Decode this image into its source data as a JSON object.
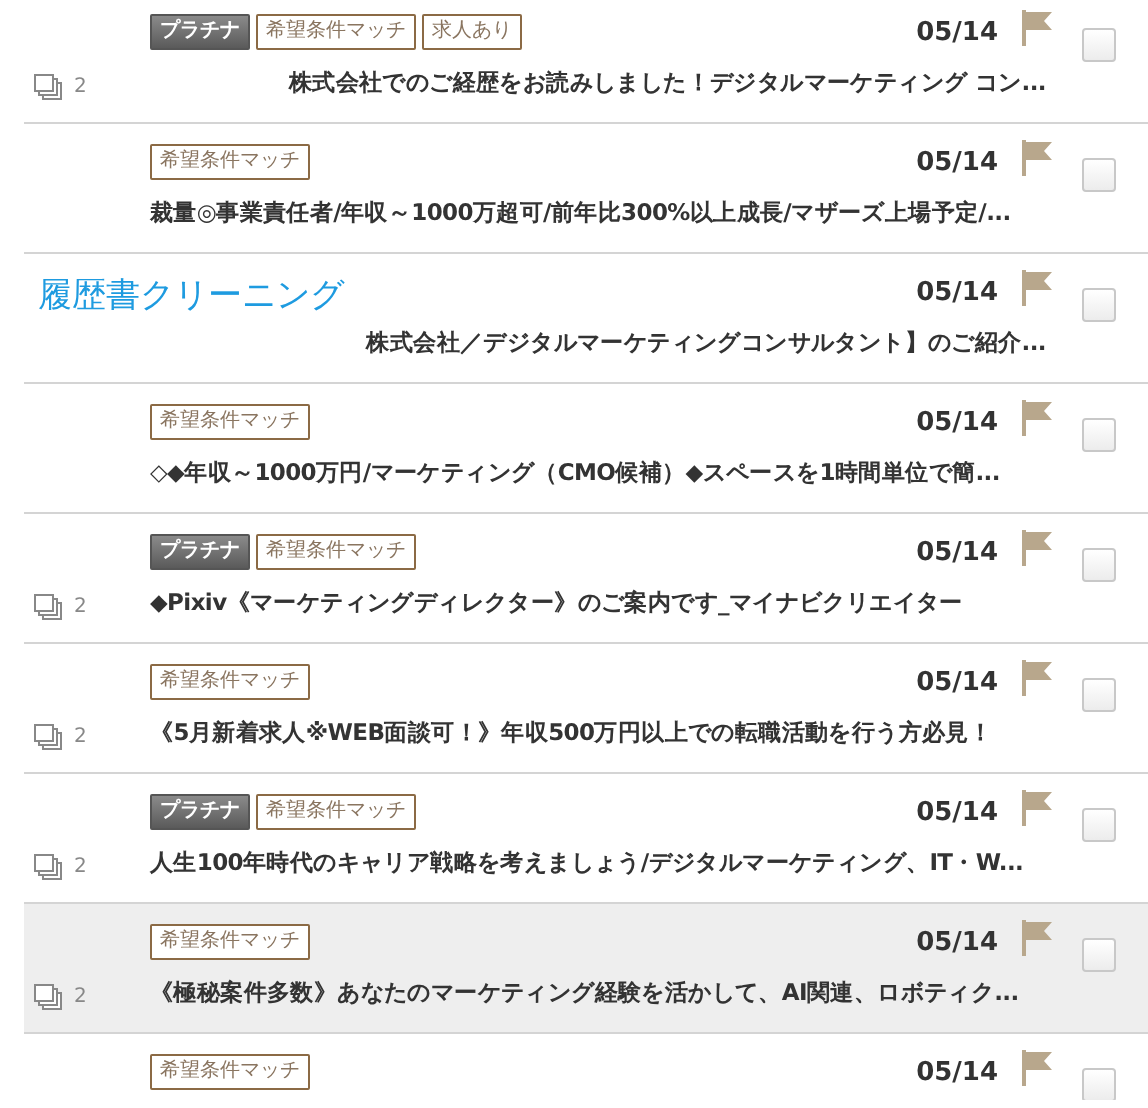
{
  "overlay": {
    "text": "履歴書クリーニング"
  },
  "rows": [
    {
      "highlighted": false,
      "covered": true,
      "thread_count": "2",
      "tags": [
        {
          "kind": "platinum",
          "label": "プラチナ"
        },
        {
          "kind": "outline",
          "label": "希望条件マッチ"
        },
        {
          "kind": "outline",
          "label": "求人あり"
        }
      ],
      "date": "05/14",
      "title": "株式会社でのご経歴をお読みしました！デジタルマーケティング コン...",
      "checked": false
    },
    {
      "highlighted": false,
      "covered": false,
      "tags": [
        {
          "kind": "outline",
          "label": "希望条件マッチ"
        }
      ],
      "date": "05/14",
      "title": "裁量◎事業責任者/年収～1000万超可/前年比300%以上成長/マザーズ上場予定/...",
      "checked": false
    },
    {
      "highlighted": false,
      "covered": true,
      "tags": [],
      "date": "05/14",
      "title": "株式会社／デジタルマーケティングコンサルタント】のご紹介...",
      "checked": false
    },
    {
      "highlighted": false,
      "covered": false,
      "tags": [
        {
          "kind": "outline",
          "label": "希望条件マッチ"
        }
      ],
      "date": "05/14",
      "title": "◇◆年収～1000万円/マーケティング（CMO候補）◆スペースを1時間単位で簡...",
      "checked": false
    },
    {
      "highlighted": false,
      "covered": false,
      "thread_count": "2",
      "tags": [
        {
          "kind": "platinum",
          "label": "プラチナ"
        },
        {
          "kind": "outline",
          "label": "希望条件マッチ"
        }
      ],
      "date": "05/14",
      "title": "◆Pixiv《マーケティングディレクター》のご案内です_マイナビクリエイター",
      "checked": false
    },
    {
      "highlighted": false,
      "covered": false,
      "thread_count": "2",
      "tags": [
        {
          "kind": "outline",
          "label": "希望条件マッチ"
        }
      ],
      "date": "05/14",
      "title": "《5月新着求人※WEB面談可！》年収500万円以上での転職活動を行う方必見！",
      "checked": false
    },
    {
      "highlighted": false,
      "covered": false,
      "thread_count": "2",
      "tags": [
        {
          "kind": "platinum",
          "label": "プラチナ"
        },
        {
          "kind": "outline",
          "label": "希望条件マッチ"
        }
      ],
      "date": "05/14",
      "title": "人生100年時代のキャリア戦略を考えましょう/デジタルマーケティング、IT・W...",
      "checked": false
    },
    {
      "highlighted": true,
      "covered": false,
      "thread_count": "2",
      "tags": [
        {
          "kind": "outline",
          "label": "希望条件マッチ"
        }
      ],
      "date": "05/14",
      "title": "《極秘案件多数》あなたのマーケティング経験を活かして、AI関連、ロボティク...",
      "checked": false
    },
    {
      "highlighted": false,
      "tags": [
        {
          "kind": "outline",
          "label": "希望条件マッチ"
        }
      ],
      "date": "05/14",
      "checked": false
    }
  ]
}
